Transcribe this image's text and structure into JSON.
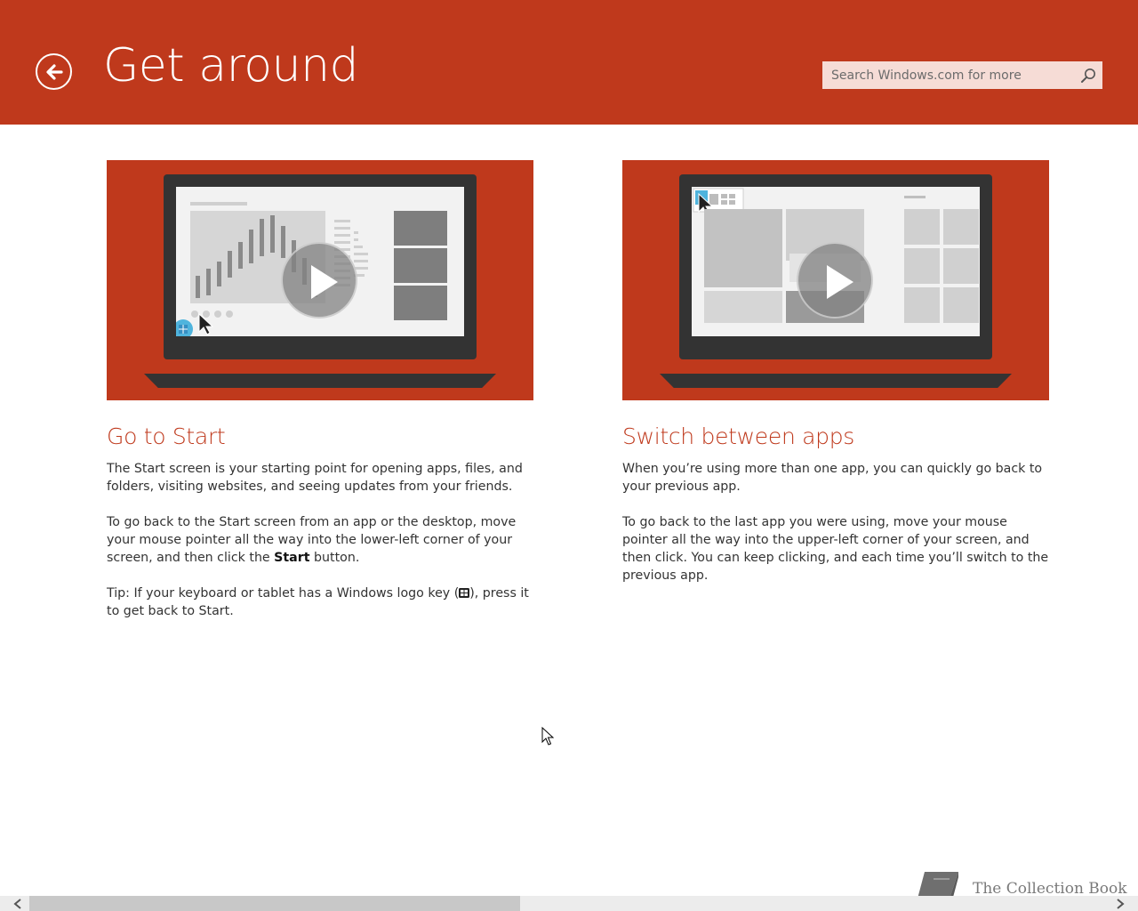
{
  "header": {
    "title": "Get around",
    "search_placeholder": "Search Windows.com for more"
  },
  "colors": {
    "accent": "#bf391c",
    "text": "#333333",
    "search_bg": "#f6dcd6"
  },
  "cards": [
    {
      "title": "Go to Start",
      "p1": "The Start screen is your starting point for opening apps, files, and folders, visiting websites, and seeing updates from your friends.",
      "p2_before": "To go back to the Start screen from an app or the desktop, move your mouse pointer all the way into the lower-left corner of your screen, and then click the ",
      "p2_bold": "Start",
      "p2_after": " button.",
      "p3_before": "Tip: If your keyboard or tablet has a Windows logo key (",
      "p3_after": "), press it to get back to Start."
    },
    {
      "title": "Switch between apps",
      "p1": "When you’re using more than one app, you can quickly go back to your previous app.",
      "p2": "To go back to the last app you were using, move your mouse pointer all the way into the upper-left corner of your screen, and then click. You can keep clicking, and each time you’ll switch to the previous app."
    }
  ],
  "icons": {
    "back": "back-arrow-icon",
    "search": "search-icon",
    "play": "play-icon",
    "windows_key": "windows-logo-icon",
    "watermark": "book-icon"
  },
  "watermark": {
    "text": "The Collection Book"
  },
  "scrollbar": {
    "position_fraction": 0.0,
    "visible_fraction": 0.45
  }
}
